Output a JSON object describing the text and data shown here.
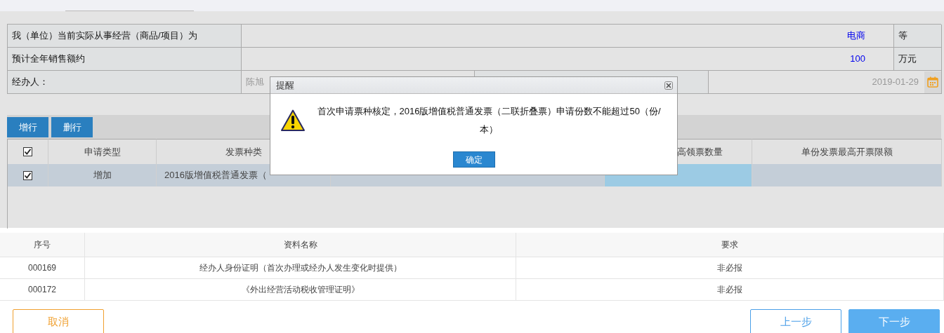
{
  "form_rows": [
    {
      "label": "我（单位）当前实际从事经营（商品/项目）为",
      "value": "电商",
      "unit": "等"
    },
    {
      "label": "预计全年销售额约",
      "value": "100",
      "unit": "万元"
    }
  ],
  "handler": {
    "label": "经办人：",
    "name": "陈旭",
    "date": "2019-01-29"
  },
  "toolbar": [
    "增行",
    "删行"
  ],
  "grid": {
    "header_checked": true,
    "columns": [
      "申请类型",
      "发票种类",
      "高领票数量",
      "单份发票最高开票限额"
    ],
    "rows": [
      {
        "checked": true,
        "selected": true,
        "cells": [
          {
            "text": "增加",
            "selected": false
          },
          {
            "text": "2016版增值税普通发票（",
            "selected": false
          },
          {
            "selected": true
          },
          {
            "selected": false
          }
        ]
      }
    ]
  },
  "dialog": {
    "title": "提醒",
    "message": "首次申请票种核定，2016版增值税普通发票（二联折叠票）申请份数不能超过50（份/本）",
    "button": "确定"
  },
  "documents": {
    "columns": [
      "序号",
      "资料名称",
      "要求"
    ],
    "rows": [
      [
        "000169",
        "经办人身份证明（首次办理或经办人发生变化时提供）",
        "非必报"
      ],
      [
        "000172",
        "《外出经营活动税收管理证明》",
        "非必报"
      ]
    ]
  },
  "footer_buttons": [
    {
      "label": "取消",
      "kind": "cancel"
    },
    {
      "label": "上一步",
      "kind": "back"
    },
    {
      "label": "下一步",
      "kind": "next"
    }
  ]
}
